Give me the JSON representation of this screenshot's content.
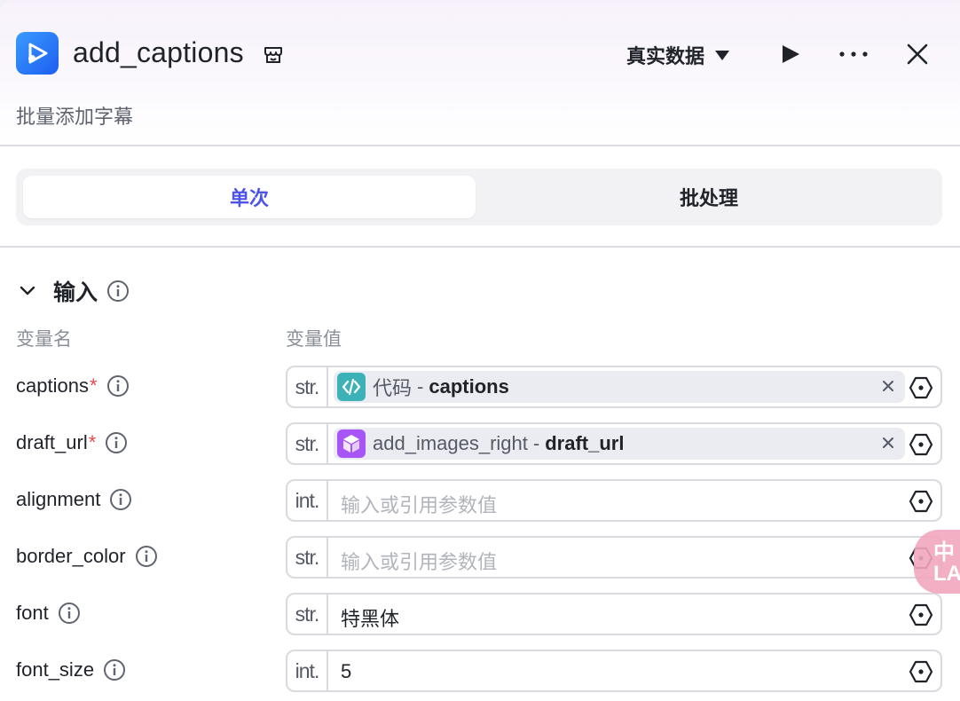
{
  "header": {
    "title": "add_captions",
    "subtitle": "批量添加字幕",
    "mode_label": "真实数据",
    "app_icon": "video-play-icon",
    "actions": [
      "play-icon",
      "more-icon",
      "close-icon"
    ]
  },
  "tabs": [
    {
      "label": "单次",
      "active": true
    },
    {
      "label": "批处理",
      "active": false
    }
  ],
  "inputs": {
    "section_label": "输入",
    "col_name": "变量名",
    "col_value": "变量值",
    "rows": [
      {
        "name": "captions",
        "required": "*",
        "type": "str.",
        "ref_source": "代码",
        "ref_sep": "-",
        "ref_param": "captions",
        "ref_kind": "code"
      },
      {
        "name": "draft_url",
        "required": "*",
        "type": "str.",
        "ref_source": "add_images_right",
        "ref_sep": "-",
        "ref_param": "draft_url",
        "ref_kind": "plugin"
      },
      {
        "name": "alignment",
        "required": "",
        "type": "int.",
        "placeholder": "输入或引用参数值"
      },
      {
        "name": "border_color",
        "required": "",
        "type": "str.",
        "placeholder": "输入或引用参数值"
      },
      {
        "name": "font",
        "required": "",
        "type": "str.",
        "value": "特黑体"
      },
      {
        "name": "font_size",
        "required": "",
        "type": "int.",
        "value": "5"
      }
    ]
  },
  "colors": {
    "accent": "#4d53e8",
    "required": "#e5484d",
    "code_chip": "#3db1b8",
    "plugin_chip": "#a855f7",
    "app_icon": "#2f7df6"
  },
  "floater_text": "中\nLA"
}
